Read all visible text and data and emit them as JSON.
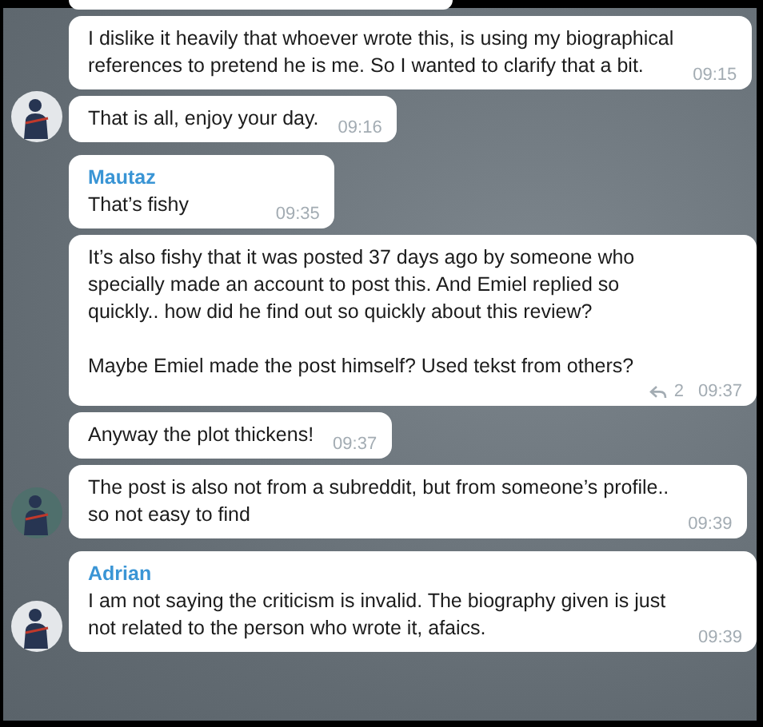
{
  "groups": [
    {
      "color": "#e4e7ea",
      "messages": [
        {
          "text": "I dislike it heavily that whoever wrote this, is using my biographical\nreferences to pretend he is me. So I wanted to clarify that a bit.",
          "time": "09:15"
        },
        {
          "text": "That is all, enjoy your day.",
          "time": "09:16"
        }
      ]
    },
    {
      "sender": "Mautaz",
      "color": "#4f6f6c",
      "messages": [
        {
          "text": "That’s fishy",
          "time": "09:35"
        },
        {
          "text": "It’s also fishy that it was posted 37 days ago by someone who\nspecially made an account to post this. And Emiel replied so\nquickly.. how did he find out so quickly about this review?\n\nMaybe Emiel made the post himself? Used tekst from others?",
          "replies": "2",
          "time": "09:37"
        },
        {
          "text": "Anyway the plot thickens!",
          "time": "09:37"
        },
        {
          "text": "The post is also not from a subreddit, but from someone’s profile..\nso not easy to find",
          "time": "09:39"
        }
      ]
    },
    {
      "sender": "Adrian",
      "color": "#e4e7ea",
      "messages": [
        {
          "text": "I am not saying the criticism is invalid. The biography given is just\nnot related to the person who wrote it, afaics.",
          "time": "09:39"
        }
      ]
    }
  ]
}
